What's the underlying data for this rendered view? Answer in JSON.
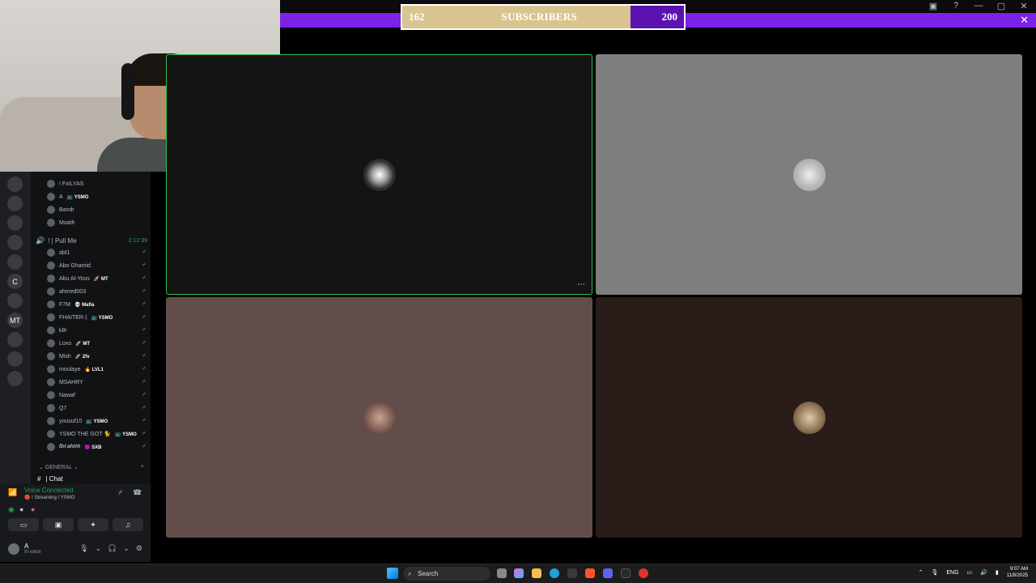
{
  "goal": {
    "current": "162",
    "label": "SUBSCRIBERS",
    "target": "200",
    "progress": 0.81
  },
  "window": {
    "close_glyph": "✕"
  },
  "servers": [
    {
      "icon": "server-icon",
      "label": ""
    },
    {
      "icon": "server-icon",
      "label": ""
    },
    {
      "icon": "server-icon",
      "label": ""
    },
    {
      "icon": "server-icon",
      "label": ""
    },
    {
      "icon": "server-icon",
      "label": ""
    },
    {
      "icon": "server-icon",
      "label": "C"
    },
    {
      "icon": "server-icon",
      "label": ""
    },
    {
      "icon": "server-icon",
      "label": "MT"
    },
    {
      "icon": "server-icon",
      "label": ""
    },
    {
      "icon": "server-icon",
      "label": ""
    },
    {
      "icon": "server-icon",
      "label": ""
    }
  ],
  "upper_voice": [
    {
      "name": "! FxILYAS",
      "tag": ""
    },
    {
      "name": "A",
      "tag": "📺 YSMO"
    },
    {
      "name": "Bandr",
      "tag": ""
    },
    {
      "name": "Moath",
      "tag": ""
    }
  ],
  "voice_channel": {
    "name": "!  |  Pull Me",
    "time": "2:12:39"
  },
  "members": [
    {
      "name": "abl1",
      "tag": ""
    },
    {
      "name": "Abo Ghamid",
      "tag": ""
    },
    {
      "name": "Abu Al-Yous",
      "tag": "🚀 MT"
    },
    {
      "name": "ahmed003",
      "tag": ""
    },
    {
      "name": "F7M",
      "tag": "💀 Mafia"
    },
    {
      "name": "FHAITER-)",
      "tag": "📺 YSMO"
    },
    {
      "name": "k8r",
      "tag": ""
    },
    {
      "name": "Loxo",
      "tag": "🚀 MT"
    },
    {
      "name": "Mish",
      "tag": "🚀 2fv"
    },
    {
      "name": "moulaye",
      "tag": "🔥 LVL1"
    },
    {
      "name": "MSAHRY",
      "tag": ""
    },
    {
      "name": "Nawaf",
      "tag": ""
    },
    {
      "name": "Q7",
      "tag": ""
    },
    {
      "name": "yousuf10",
      "tag": "📺 YSMO"
    },
    {
      "name": "YSMO THE GOT 🐈",
      "tag": "📺 YSMO"
    },
    {
      "name": "𝑰𝒃𝒓𝒂𝒉𝒊𝒎",
      "tag": "😈 SXB"
    }
  ],
  "category": {
    "name": "⌄ GENERAL ⌄",
    "plus": "+"
  },
  "chat_channel": {
    "hash": "#",
    "name": "| Chat"
  },
  "voice_panel": {
    "status": "Voice Connected",
    "sub": "🔴 ! Streaming / YSMO"
  },
  "user": {
    "name": "A",
    "status": "In voice"
  },
  "taskbar": {
    "search": "Search",
    "lang": "ENG",
    "time": "9:07 AM",
    "date": "11/8/2025"
  }
}
